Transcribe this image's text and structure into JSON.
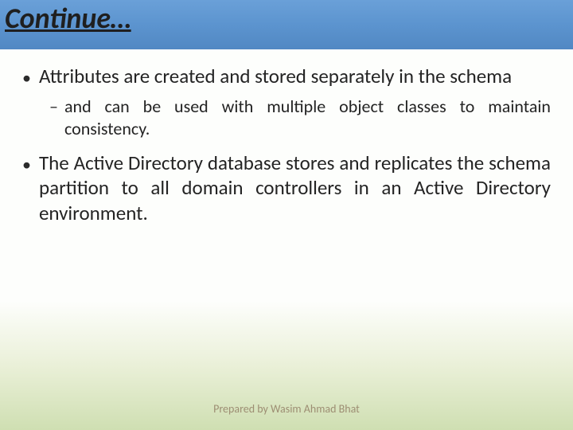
{
  "title": "Continue…",
  "bullets": [
    {
      "text": "Attributes are created and stored separately in the schema",
      "sub": [
        "and can be used with multiple object classes to maintain consistency."
      ]
    },
    {
      "text": "The Active Directory database stores and replicates the schema partition to all domain controllers in an Active Directory environment.",
      "sub": []
    }
  ],
  "footer": "Prepared by Wasim Ahmad Bhat"
}
